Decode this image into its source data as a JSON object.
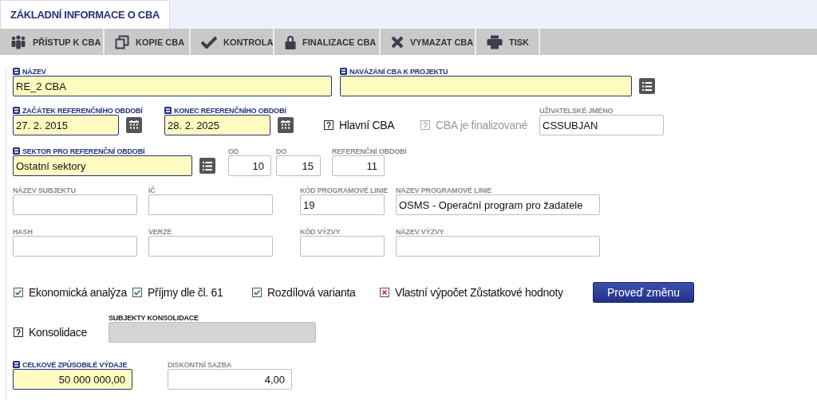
{
  "tabs": [
    {
      "label": "ZÁKLADNÍ INFORMACE O CBA",
      "selected": true
    }
  ],
  "toolbar": [
    {
      "label": "PŘÍSTUP K CBA"
    },
    {
      "label": "KOPIE CBA"
    },
    {
      "label": "KONTROLA"
    },
    {
      "label": "FINALIZACE CBA"
    },
    {
      "label": "VYMAZAT CBA"
    },
    {
      "label": "TISK"
    }
  ],
  "rows": [
    {
      "items": [
        {
          "kind": "text",
          "label": "NÁZEV",
          "value": "RE_2 CBA",
          "required": true
        },
        {
          "kind": "select",
          "label": "NAVÁZÁNÍ CBA K PROJEKTU",
          "required": true
        }
      ]
    },
    {
      "items": [
        {
          "kind": "date",
          "label": "ZAČÁTEK REFERENČNÍHO OBDOBÍ",
          "value": "27. 2. 2015",
          "required": true
        },
        {
          "kind": "date",
          "label": "KONEC REFERENČNÍHO OBDOBÍ",
          "value": "28. 2. 2025",
          "required": true
        },
        {
          "kind": "check",
          "label": "Hlavní CBA",
          "checked": false,
          "crossed": false,
          "disabled": false
        },
        {
          "kind": "check",
          "label": "CBA je finalizované",
          "checked": false,
          "crossed": false,
          "disabled": true
        },
        {
          "kind": "text",
          "label": "UŽIVATELSKÉ JMÉNO",
          "value": "CSSUBJAN",
          "required": false
        }
      ]
    },
    {
      "items": [
        {
          "kind": "select",
          "label": "SEKTOR PRO REFERENČNÍ OBDOBÍ",
          "value": "Ostatní sektory",
          "required": true
        },
        {
          "kind": "number",
          "label": "OD",
          "value": "10",
          "required": false
        },
        {
          "kind": "number",
          "label": "DO",
          "value": "15",
          "required": false
        },
        {
          "kind": "number",
          "label": "REFERENČNÍ OBDOBÍ",
          "value": "11",
          "required": false
        }
      ]
    },
    {
      "items": [
        {
          "kind": "text",
          "label": "NÁZEV SUBJEKTU",
          "required": false
        },
        {
          "kind": "text",
          "label": "IČ",
          "required": false
        },
        {
          "kind": "text",
          "label": "KÓD PROGRAMOVÉ LINIE",
          "value": "19",
          "required": false
        },
        {
          "kind": "text",
          "label": "NÁZEV PROGRAMOVÉ LINIE",
          "value": "OSMS - Operační program pro žadatele",
          "required": false
        }
      ]
    },
    {
      "items": [
        {
          "kind": "text",
          "label": "HASH",
          "required": false
        },
        {
          "kind": "text",
          "label": "VERZE",
          "required": false
        },
        {
          "kind": "text",
          "label": "KÓD VÝZVY",
          "required": false
        },
        {
          "kind": "text",
          "label": "NÁZEV VÝZVY",
          "required": false
        }
      ]
    },
    {
      "items": [
        {
          "kind": "check",
          "label": "Ekonomická analýza",
          "checked": true,
          "crossed": false,
          "disabled": false
        },
        {
          "kind": "check",
          "label": "Příjmy dle čl. 61",
          "checked": true,
          "crossed": false,
          "disabled": false
        },
        {
          "kind": "check",
          "label": "Rozdílová varianta",
          "checked": true,
          "crossed": false,
          "disabled": false
        },
        {
          "kind": "check",
          "label": "Vlastní výpočet Zůstatkové hodnoty",
          "checked": false,
          "crossed": true,
          "disabled": false
        },
        {
          "kind": "button",
          "label": "Proveď změnu"
        }
      ]
    },
    {
      "items": [
        {
          "kind": "check",
          "label": "Konsolidace",
          "checked": false,
          "crossed": false,
          "disabled": false
        },
        {
          "kind": "text",
          "label": "SUBJEKTY KONSOLIDACE",
          "required": false,
          "disabled": true
        }
      ]
    },
    {
      "items": [
        {
          "kind": "number",
          "label": "CELKOVÉ ZPŮSOBILÉ VÝDAJE",
          "value": "50 000 000,00",
          "required": true
        },
        {
          "kind": "number",
          "label": "DISKONTNÍ SAZBA",
          "value": "4,00",
          "required": false
        }
      ]
    }
  ]
}
